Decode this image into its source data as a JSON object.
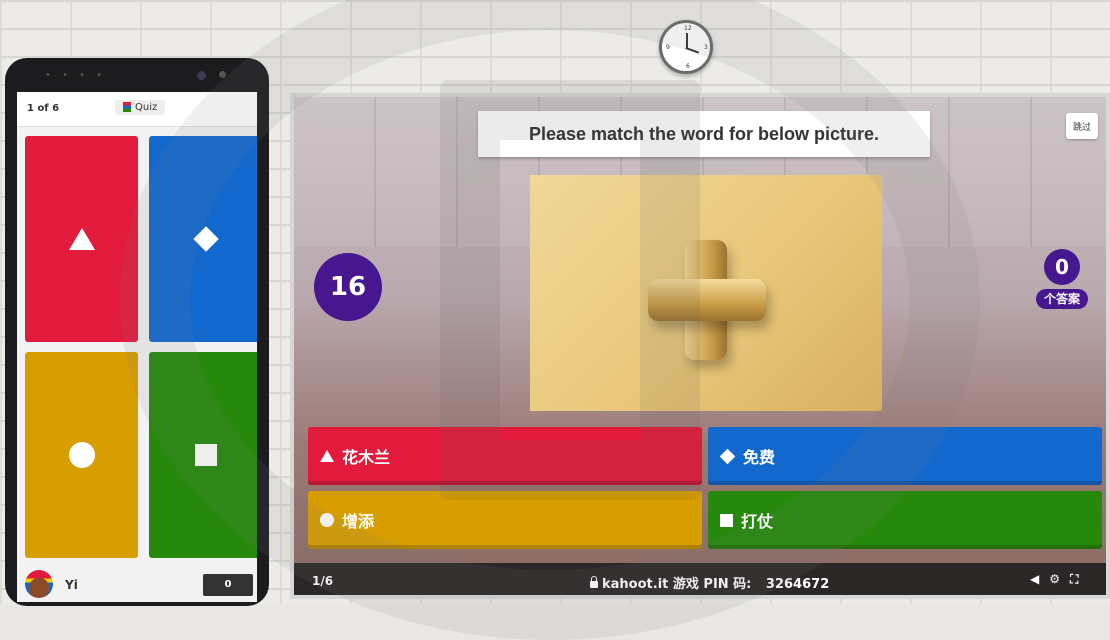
{
  "phone": {
    "question_count": "1 of 6",
    "question_type": "Quiz",
    "player_name": "Yi",
    "player_score": "0",
    "tiles": [
      {
        "color": "#e21b3c",
        "shape": "triangle-icon"
      },
      {
        "color": "#1368ce",
        "shape": "diamond-icon"
      },
      {
        "color": "#d89e00",
        "shape": "circle-icon"
      },
      {
        "color": "#26890c",
        "shape": "square-icon"
      }
    ]
  },
  "game": {
    "question": "Please match the word for below picture.",
    "skip_label": "跳过",
    "timer": "16",
    "answers_count": "0",
    "answers_label": "个答案",
    "image_icon": "plus-icon",
    "answers": [
      {
        "label": "花木兰",
        "color": "#e21b3c",
        "shape": "triangle-icon"
      },
      {
        "label": "免费",
        "color": "#1368ce",
        "shape": "diamond-icon"
      },
      {
        "label": "增添",
        "color": "#d89e00",
        "shape": "circle-icon"
      },
      {
        "label": "打仗",
        "color": "#26890c",
        "shape": "square-icon"
      }
    ],
    "footer": {
      "progress": "1/6",
      "site": "kahoot.it",
      "pin_label": "游戏 PIN 码:",
      "pin": "3264672",
      "icons": [
        "volume-icon",
        "settings-icon",
        "fullscreen-icon"
      ]
    }
  },
  "colors": {
    "purple": "#46178f"
  }
}
